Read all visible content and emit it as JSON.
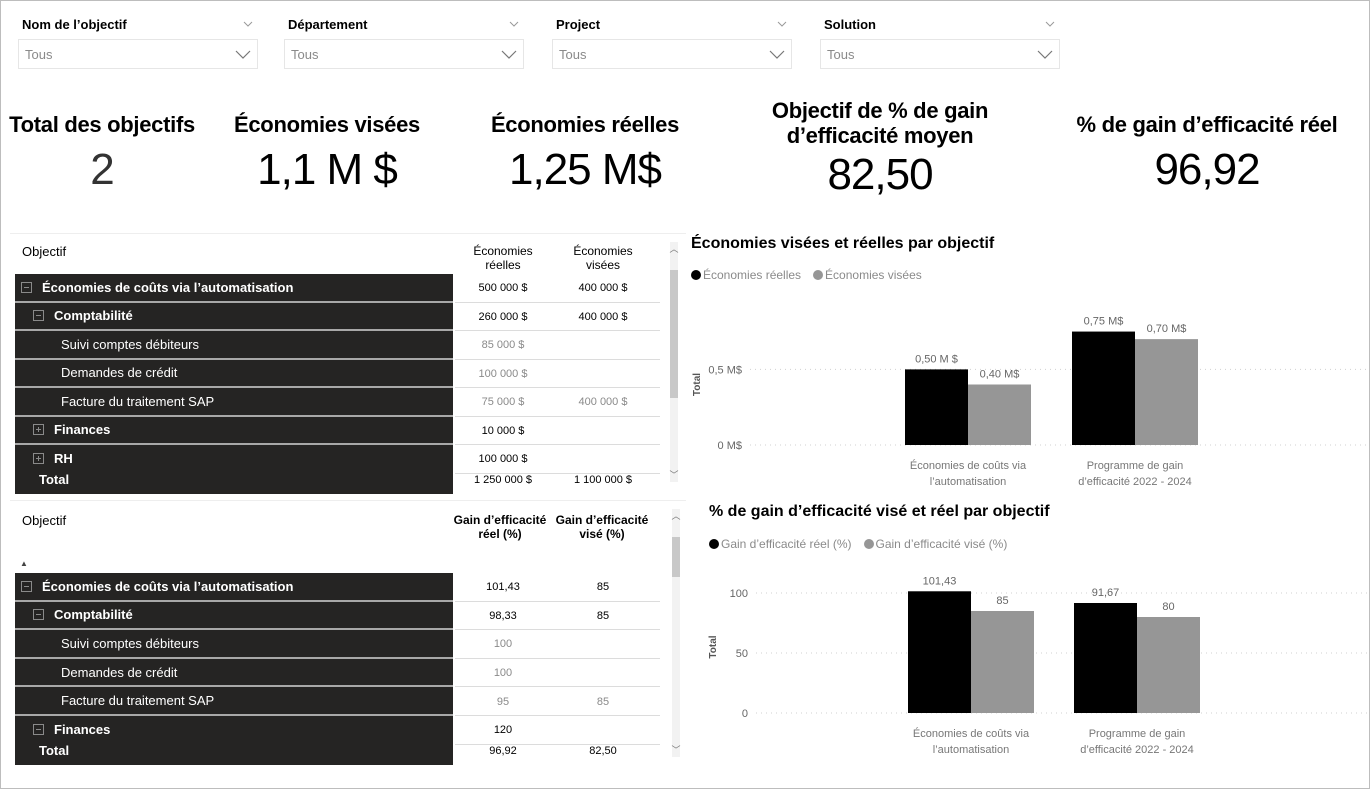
{
  "filters": [
    {
      "label": "Nom de l’objectif",
      "value": "Tous"
    },
    {
      "label": "Département",
      "value": "Tous"
    },
    {
      "label": "Project",
      "value": "Tous"
    },
    {
      "label": "Solution",
      "value": "Tous"
    }
  ],
  "kpis": [
    {
      "title": "Total des objectifs",
      "value": "2"
    },
    {
      "title": "Économies visées",
      "value": "1,1 M $"
    },
    {
      "title": "Économies réelles",
      "value": "1,25 M$"
    },
    {
      "title": "Objectif de % de gain d’efficacité moyen",
      "value": "82,50"
    },
    {
      "title": "% de gain d’efficacité réel",
      "value": "96,92"
    }
  ],
  "savings_matrix": {
    "row_header": "Objectif",
    "col1": "Économies réelles",
    "col2": "Économies visées",
    "rows": [
      {
        "label": "Économies de coûts via l’automatisation",
        "level": 0,
        "expander": "minus",
        "v1": "500 000 $",
        "v2": "400 000 $",
        "muted": false
      },
      {
        "label": "Comptabilité",
        "level": 1,
        "expander": "minus",
        "v1": "260 000 $",
        "v2": "400 000 $",
        "muted": false
      },
      {
        "label": "Suivi comptes débiteurs",
        "level": 2,
        "expander": "",
        "v1": "85 000 $",
        "v2": "",
        "muted": true
      },
      {
        "label": "Demandes de crédit",
        "level": 2,
        "expander": "",
        "v1": "100 000 $",
        "v2": "",
        "muted": true
      },
      {
        "label": "Facture du traitement SAP",
        "level": 2,
        "expander": "",
        "v1": "75 000 $",
        "v2": "400 000 $",
        "muted": true
      },
      {
        "label": "Finances",
        "level": 1,
        "expander": "plus",
        "v1": "10 000 $",
        "v2": "",
        "muted": false
      },
      {
        "label": "RH",
        "level": 1,
        "expander": "plus",
        "v1": "100 000 $",
        "v2": "",
        "muted": false
      }
    ],
    "total_label": "Total",
    "total_v1": "1 250 000 $",
    "total_v2": "1 100 000 $"
  },
  "efficiency_matrix": {
    "row_header": "Objectif",
    "col1": "Gain d’efficacité réel (%)",
    "col2": "Gain d’efficacité visé (%)",
    "rows": [
      {
        "label": "Économies de coûts via l’automatisation",
        "level": 0,
        "expander": "minus",
        "v1": "101,43",
        "v2": "85",
        "muted": false
      },
      {
        "label": "Comptabilité",
        "level": 1,
        "expander": "minus",
        "v1": "98,33",
        "v2": "85",
        "muted": false
      },
      {
        "label": "Suivi comptes débiteurs",
        "level": 2,
        "expander": "",
        "v1": "100",
        "v2": "",
        "muted": true
      },
      {
        "label": "Demandes de crédit",
        "level": 2,
        "expander": "",
        "v1": "100",
        "v2": "",
        "muted": true
      },
      {
        "label": "Facture du traitement SAP",
        "level": 2,
        "expander": "",
        "v1": "95",
        "v2": "85",
        "muted": true
      },
      {
        "label": "Finances",
        "level": 1,
        "expander": "minus",
        "v1": "120",
        "v2": "",
        "muted": false
      }
    ],
    "total_label": "Total",
    "total_v1": "96,92",
    "total_v2": "82,50"
  },
  "colors": {
    "actual": "#000000",
    "target": "#969696"
  },
  "chart_data": [
    {
      "type": "bar",
      "title": "Économies visées et réelles par objectif",
      "categories": [
        "Économies de coûts via l’automatisation",
        "Programme de gain d’efficacité 2022 - 2024"
      ],
      "category_lines": [
        [
          "Économies de coûts via",
          "l’automatisation"
        ],
        [
          "Programme de gain",
          "d’efficacité 2022 - 2024"
        ]
      ],
      "series": [
        {
          "name": "Économies réelles",
          "values": [
            0.5,
            0.75
          ],
          "labels": [
            "0,50 M $",
            "0,75 M$"
          ]
        },
        {
          "name": "Économies visées",
          "values": [
            0.4,
            0.7
          ],
          "labels": [
            "0,40 M$",
            "0,70 M$"
          ]
        }
      ],
      "ylabel": "Total",
      "yticks": [
        0,
        0.5
      ],
      "ytick_labels": [
        "0 M$",
        "0,5 M$"
      ],
      "ylim": [
        0,
        0.8
      ],
      "grid": true,
      "legend": "top-left"
    },
    {
      "type": "bar",
      "title": "% de gain d’efficacité visé et réel par objectif",
      "categories": [
        "Économies de coûts via l’automatisation",
        "Programme de gain d’efficacité 2022 - 2024"
      ],
      "category_lines": [
        [
          "Économies de coûts via",
          "l’automatisation"
        ],
        [
          "Programme de gain",
          "d’efficacité 2022 - 2024"
        ]
      ],
      "series": [
        {
          "name": "Gain d’efficacité réel (%)",
          "values": [
            101.43,
            91.67
          ],
          "labels": [
            "101,43",
            "91,67"
          ]
        },
        {
          "name": "Gain d’efficacité visé (%)",
          "values": [
            85,
            80
          ],
          "labels": [
            "85",
            "80"
          ]
        }
      ],
      "ylabel": "Total",
      "yticks": [
        0,
        50,
        100
      ],
      "ytick_labels": [
        "0",
        "50",
        "100"
      ],
      "ylim": [
        0,
        110
      ],
      "grid": true,
      "legend": "top-left"
    }
  ]
}
